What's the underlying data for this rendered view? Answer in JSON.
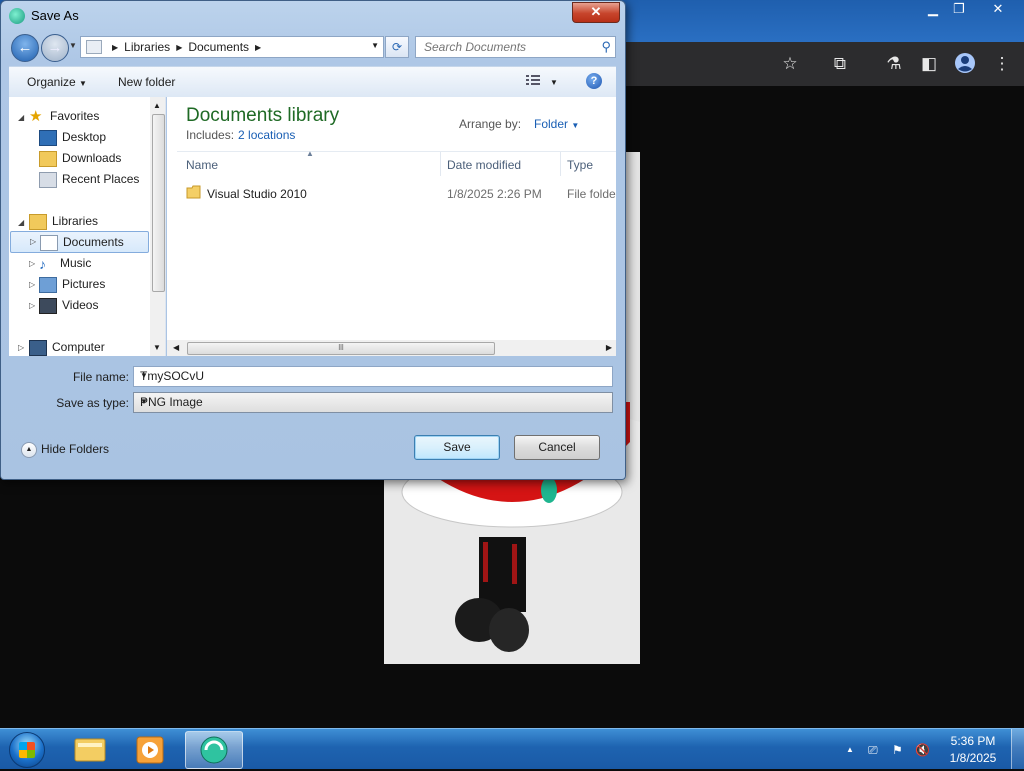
{
  "dialog": {
    "title": "Save As",
    "close_glyph": "✕",
    "breadcrumb": [
      "Libraries",
      "Documents"
    ],
    "search_placeholder": "Search Documents",
    "toolbar": {
      "organize_label": "Organize",
      "new_folder_label": "New folder",
      "help_glyph": "?"
    },
    "nav": {
      "favorites_label": "Favorites",
      "favorites": [
        "Desktop",
        "Downloads",
        "Recent Places"
      ],
      "libraries_label": "Libraries",
      "libraries": [
        "Documents",
        "Music",
        "Pictures",
        "Videos"
      ],
      "computer_label": "Computer",
      "selected": "Documents"
    },
    "library": {
      "title": "Documents library",
      "includes_label": "Includes:",
      "includes_link": "2 locations",
      "arrange_by_label": "Arrange by:",
      "arrange_by_value": "Folder"
    },
    "columns": {
      "name": "Name",
      "date_modified": "Date modified",
      "type": "Type"
    },
    "files": [
      {
        "name": "Visual Studio 2010",
        "date_modified": "1/8/2025 2:26 PM",
        "type": "File folder"
      }
    ],
    "scroll_grip": "lll",
    "file_name_label": "File name:",
    "file_name_value": "TmySOCvU",
    "save_as_type_label": "Save as type:",
    "save_as_type_value": "PNG Image",
    "hide_folders_label": "Hide Folders",
    "save_label": "Save",
    "cancel_label": "Cancel"
  },
  "taskbar": {
    "time": "5:36 PM",
    "date": "1/8/2025"
  },
  "colors": {
    "library_title": "#1f6a25",
    "link": "#1a5fb4",
    "taskbar": "#1e63b0"
  }
}
